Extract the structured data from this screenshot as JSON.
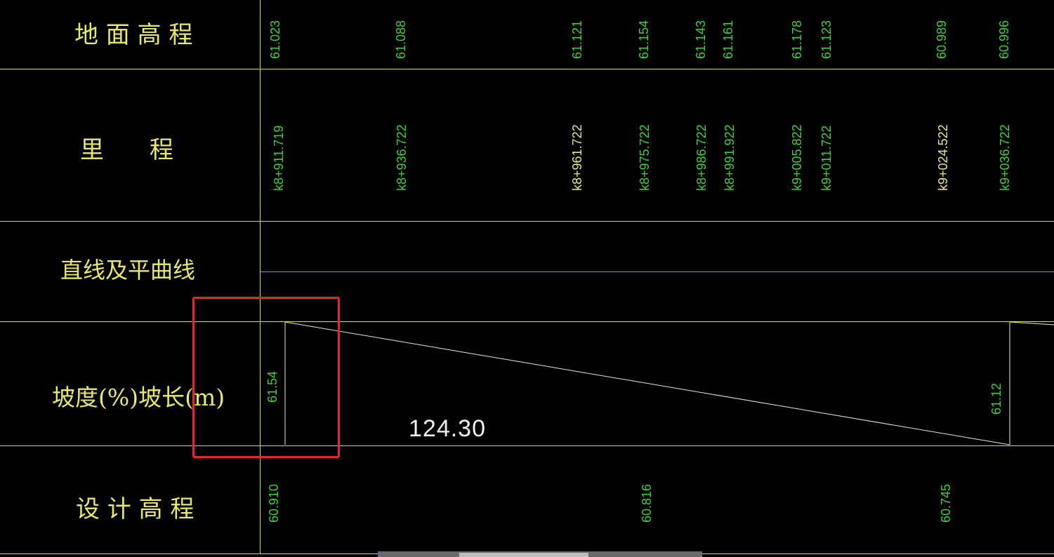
{
  "rows": {
    "ground_elevation": "地 面 高 程",
    "chainage": "里      程",
    "alignment": "直线及平曲线",
    "grade": "坡度(%)坡长(m)",
    "design_elevation": "设 计 高 程"
  },
  "ground_elevations": [
    "61.023",
    "61.088",
    "61.121",
    "61.154",
    "61.143",
    "61.161",
    "61.178",
    "61.123",
    "60.989",
    "60.996"
  ],
  "chainages": [
    "k8+911.719",
    "k8+936.722",
    "k8+961.722",
    "k8+975.722",
    "k8+986.722",
    "k8+991.922",
    "k9+005.822",
    "k9+011.722",
    "k9+024.522",
    "k9+036.722"
  ],
  "grade_section": {
    "start_elevation": "61.54",
    "length": "124.30",
    "end_elevation": "61.12"
  },
  "design_elevations": [
    "60.910",
    "60.816",
    "60.745"
  ]
}
